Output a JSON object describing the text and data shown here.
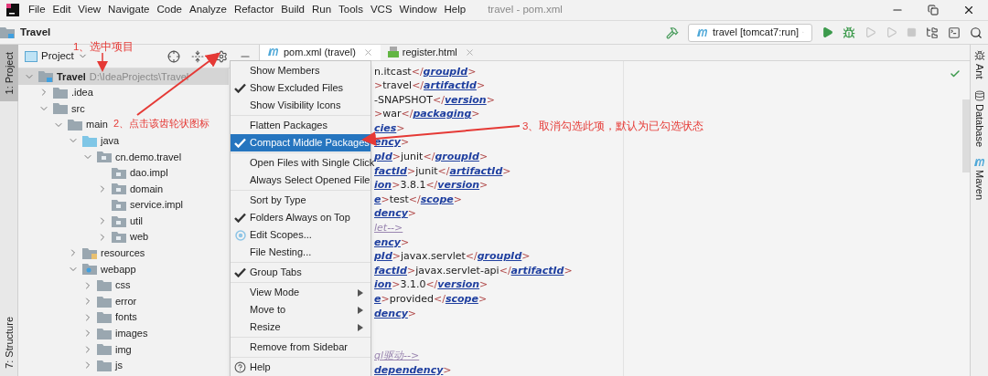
{
  "menu_bar": [
    "File",
    "Edit",
    "View",
    "Navigate",
    "Code",
    "Analyze",
    "Refactor",
    "Build",
    "Run",
    "Tools",
    "VCS",
    "Window",
    "Help"
  ],
  "window": {
    "title": "travel - pom.xml"
  },
  "navbar": {
    "crumb": "Travel",
    "run_config": "travel [tomcat7:run]"
  },
  "left_stripe": [
    {
      "label": "1: Project",
      "selected": true
    },
    {
      "label": "7: Structure",
      "selected": false
    }
  ],
  "right_stripe": [
    {
      "label": "Ant",
      "kind": "ant"
    },
    {
      "label": "Database",
      "kind": "database"
    },
    {
      "label": "Maven",
      "kind": "maven"
    }
  ],
  "project_panel": {
    "view": "Project"
  },
  "tree": [
    {
      "label": "Travel",
      "path": "D:\\IdeaProjects\\Travel",
      "kind": "project",
      "expanded": true,
      "selected": true,
      "children": [
        {
          "label": ".idea",
          "kind": "folder",
          "expanded": false,
          "selected": false
        },
        {
          "label": "src",
          "kind": "folder",
          "expanded": true,
          "selected": false,
          "children": [
            {
              "label": "main",
              "kind": "folder",
              "expanded": true,
              "selected": false,
              "children": [
                {
                  "label": "java",
                  "kind": "source",
                  "expanded": true,
                  "selected": false,
                  "children": [
                    {
                      "label": "cn.demo.travel",
                      "kind": "package",
                      "expanded": true,
                      "selected": false,
                      "children": [
                        {
                          "label": "dao.impl",
                          "kind": "package_leaf",
                          "expanded": false,
                          "selected": false
                        },
                        {
                          "label": "domain",
                          "kind": "package",
                          "expanded": false,
                          "selected": false
                        },
                        {
                          "label": "service.impl",
                          "kind": "package_leaf",
                          "expanded": false,
                          "selected": false
                        },
                        {
                          "label": "util",
                          "kind": "package",
                          "expanded": false,
                          "selected": false
                        },
                        {
                          "label": "web",
                          "kind": "package",
                          "expanded": false,
                          "selected": false
                        }
                      ]
                    }
                  ]
                },
                {
                  "label": "resources",
                  "kind": "resources",
                  "expanded": false,
                  "selected": false
                },
                {
                  "label": "webapp",
                  "kind": "webapp",
                  "expanded": true,
                  "selected": false,
                  "children": [
                    {
                      "label": "css",
                      "kind": "folder",
                      "expanded": false,
                      "selected": false
                    },
                    {
                      "label": "error",
                      "kind": "folder",
                      "expanded": false,
                      "selected": false
                    },
                    {
                      "label": "fonts",
                      "kind": "folder",
                      "expanded": false,
                      "selected": false
                    },
                    {
                      "label": "images",
                      "kind": "folder",
                      "expanded": false,
                      "selected": false
                    },
                    {
                      "label": "img",
                      "kind": "folder",
                      "expanded": false,
                      "selected": false
                    },
                    {
                      "label": "js",
                      "kind": "folder",
                      "expanded": false,
                      "selected": false
                    }
                  ]
                }
              ]
            }
          ]
        }
      ]
    }
  ],
  "tabs": [
    {
      "label": "pom.xml (travel)",
      "kind": "maven",
      "selected": true
    },
    {
      "label": "register.html",
      "kind": "html",
      "selected": false
    }
  ],
  "code_blocks": [
    [
      [
        {
          "kind": "text",
          "t": "n.itcast"
        },
        {
          "kind": "br",
          "t": "</"
        },
        {
          "kind": "tag",
          "t": "groupId"
        },
        {
          "kind": "br",
          "t": ">"
        }
      ],
      [
        {
          "kind": "br",
          "t": ">"
        },
        {
          "kind": "text",
          "t": "travel"
        },
        {
          "kind": "br",
          "t": "</"
        },
        {
          "kind": "tag",
          "t": "artifactId"
        },
        {
          "kind": "br",
          "t": ">"
        }
      ],
      [
        {
          "kind": "text",
          "t": "-SNAPSHOT"
        },
        {
          "kind": "br",
          "t": "</"
        },
        {
          "kind": "tag",
          "t": "version"
        },
        {
          "kind": "br",
          "t": ">"
        }
      ],
      [
        {
          "kind": "br",
          "t": ">"
        },
        {
          "kind": "text",
          "t": "war"
        },
        {
          "kind": "br",
          "t": "</"
        },
        {
          "kind": "tag",
          "t": "packaging"
        },
        {
          "kind": "br",
          "t": ">"
        }
      ],
      [
        {
          "kind": "tag",
          "t": "cies"
        },
        {
          "kind": "br",
          "t": ">"
        }
      ],
      [
        {
          "kind": "tag",
          "t": "ency"
        },
        {
          "kind": "br",
          "t": ">"
        }
      ],
      [
        {
          "kind": "tag",
          "t": "pId"
        },
        {
          "kind": "br",
          "t": ">"
        },
        {
          "kind": "text",
          "t": "junit"
        },
        {
          "kind": "br",
          "t": "</"
        },
        {
          "kind": "tag",
          "t": "groupId"
        },
        {
          "kind": "br",
          "t": ">"
        }
      ],
      [
        {
          "kind": "tag",
          "t": "factId"
        },
        {
          "kind": "br",
          "t": ">"
        },
        {
          "kind": "text",
          "t": "junit"
        },
        {
          "kind": "br",
          "t": "</"
        },
        {
          "kind": "tag",
          "t": "artifactId"
        },
        {
          "kind": "br",
          "t": ">"
        }
      ],
      [
        {
          "kind": "tag",
          "t": "ion"
        },
        {
          "kind": "br",
          "t": ">"
        },
        {
          "kind": "text",
          "t": "3.8.1"
        },
        {
          "kind": "br",
          "t": "</"
        },
        {
          "kind": "tag",
          "t": "version"
        },
        {
          "kind": "br",
          "t": ">"
        }
      ],
      [
        {
          "kind": "tag",
          "t": "e"
        },
        {
          "kind": "br",
          "t": ">"
        },
        {
          "kind": "text",
          "t": "test"
        },
        {
          "kind": "br",
          "t": "</"
        },
        {
          "kind": "tag",
          "t": "scope"
        },
        {
          "kind": "br",
          "t": ">"
        }
      ],
      [
        {
          "kind": "tag",
          "t": "dency"
        },
        {
          "kind": "br",
          "t": ">"
        }
      ],
      [
        {
          "kind": "comment",
          "t": "let-->"
        }
      ],
      [
        {
          "kind": "tag",
          "t": "ency"
        },
        {
          "kind": "br",
          "t": ">"
        }
      ],
      [
        {
          "kind": "tag",
          "t": "pId"
        },
        {
          "kind": "br",
          "t": ">"
        },
        {
          "kind": "text",
          "t": "javax.servlet"
        },
        {
          "kind": "br",
          "t": "</"
        },
        {
          "kind": "tag",
          "t": "groupId"
        },
        {
          "kind": "br",
          "t": ">"
        }
      ],
      [
        {
          "kind": "tag",
          "t": "factId"
        },
        {
          "kind": "br",
          "t": ">"
        },
        {
          "kind": "text",
          "t": "javax.servlet-api"
        },
        {
          "kind": "br",
          "t": "</"
        },
        {
          "kind": "tag",
          "t": "artifactId"
        },
        {
          "kind": "br",
          "t": ">"
        }
      ],
      [
        {
          "kind": "tag",
          "t": "ion"
        },
        {
          "kind": "br",
          "t": ">"
        },
        {
          "kind": "text",
          "t": "3.1.0"
        },
        {
          "kind": "br",
          "t": "</"
        },
        {
          "kind": "tag",
          "t": "version"
        },
        {
          "kind": "br",
          "t": ">"
        }
      ],
      [
        {
          "kind": "tag",
          "t": "e"
        },
        {
          "kind": "br",
          "t": ">"
        },
        {
          "kind": "text",
          "t": "provided"
        },
        {
          "kind": "br",
          "t": "</"
        },
        {
          "kind": "tag",
          "t": "scope"
        },
        {
          "kind": "br",
          "t": ">"
        }
      ],
      [
        {
          "kind": "tag",
          "t": "dency"
        },
        {
          "kind": "br",
          "t": ">"
        }
      ]
    ],
    [
      [
        {
          "kind": "comment",
          "t": "ql驱动-->"
        }
      ],
      [
        {
          "kind": "tag",
          "t": "dependency"
        },
        {
          "kind": "br",
          "t": ">"
        }
      ]
    ]
  ],
  "menu": [
    [
      {
        "label": "Show Members",
        "kind": "check",
        "checked": false,
        "selected": false
      },
      {
        "label": "Show Excluded Files",
        "kind": "check",
        "checked": true,
        "selected": false
      },
      {
        "label": "Show Visibility Icons",
        "kind": "check",
        "checked": false,
        "selected": false
      }
    ],
    [
      {
        "label": "Flatten Packages",
        "kind": "check",
        "checked": false,
        "selected": false
      },
      {
        "label": "Compact Middle Packages",
        "kind": "check",
        "checked": true,
        "selected": true
      }
    ],
    [
      {
        "label": "Open Files with Single Click",
        "kind": "check",
        "checked": false,
        "selected": false
      },
      {
        "label": "Always Select Opened File",
        "kind": "check",
        "checked": false,
        "selected": false
      }
    ],
    [
      {
        "label": "Sort by Type",
        "kind": "check",
        "checked": false,
        "selected": false
      },
      {
        "label": "Folders Always on Top",
        "kind": "check",
        "checked": true,
        "selected": false
      },
      {
        "label": "Edit Scopes...",
        "kind": "scopes",
        "selected": false
      },
      {
        "label": "File Nesting...",
        "kind": "plain",
        "selected": false
      }
    ],
    [
      {
        "label": "Group Tabs",
        "kind": "check",
        "checked": true,
        "selected": false
      }
    ],
    [
      {
        "label": "View Mode",
        "kind": "submenu",
        "selected": false
      },
      {
        "label": "Move to",
        "kind": "submenu",
        "selected": false
      },
      {
        "label": "Resize",
        "kind": "submenu",
        "selected": false
      }
    ],
    [
      {
        "label": "Remove from Sidebar",
        "kind": "plain",
        "selected": false
      }
    ],
    [
      {
        "label": "Help",
        "kind": "help",
        "selected": false
      }
    ]
  ],
  "annotations": [
    "1、选中项目",
    "2、点击该齿轮状图标",
    "3、取消勾选此项，默认为已勾选状态"
  ]
}
